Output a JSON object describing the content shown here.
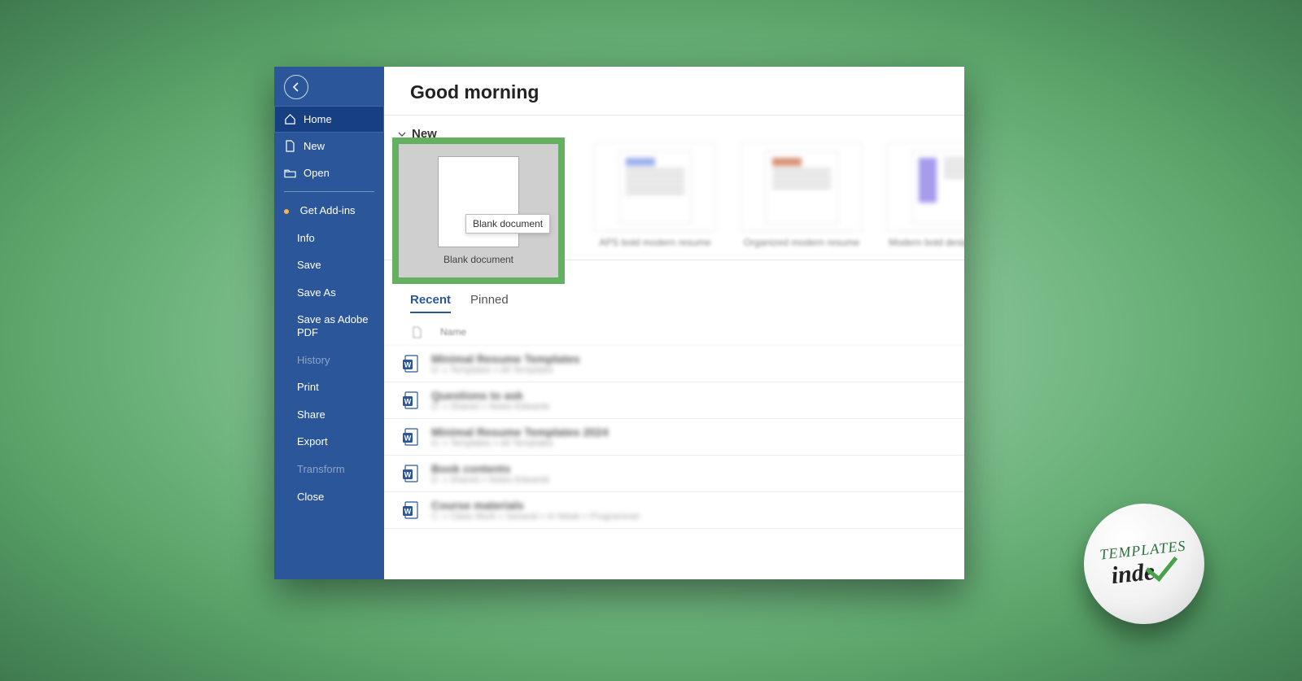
{
  "greeting": "Good morning",
  "sections": {
    "new": "New"
  },
  "sidebar": {
    "home": "Home",
    "new": "New",
    "open": "Open",
    "get_addins": "Get Add-ins",
    "info": "Info",
    "save": "Save",
    "save_as": "Save As",
    "save_as_pdf": "Save as Adobe PDF",
    "history": "History",
    "print": "Print",
    "share": "Share",
    "export": "Export",
    "transform": "Transform",
    "close": "Close"
  },
  "templates": {
    "blank": "Blank document",
    "tooltip": "Blank document",
    "t1": "APS bold modern resume",
    "t2": "Organized modern resume",
    "t3": "Modern bold designer res..."
  },
  "tabs": {
    "recent": "Recent",
    "pinned": "Pinned"
  },
  "list": {
    "header_name": "Name",
    "items": [
      {
        "title": "Minimal Resume Templates",
        "path": "D: » Templates » All Templates"
      },
      {
        "title": "Questions to ask",
        "path": "D: » Shared » Notes Edwards"
      },
      {
        "title": "Minimal Resume Templates 2024",
        "path": "D: » Templates » All Templates"
      },
      {
        "title": "Book contents",
        "path": "D: » Shared » Notes Edwards"
      },
      {
        "title": "Course materials",
        "path": "C: » Class Work » General » In Week » Programmer"
      }
    ]
  },
  "logo": {
    "top": "TEMPLATES",
    "bottom": "inde"
  }
}
